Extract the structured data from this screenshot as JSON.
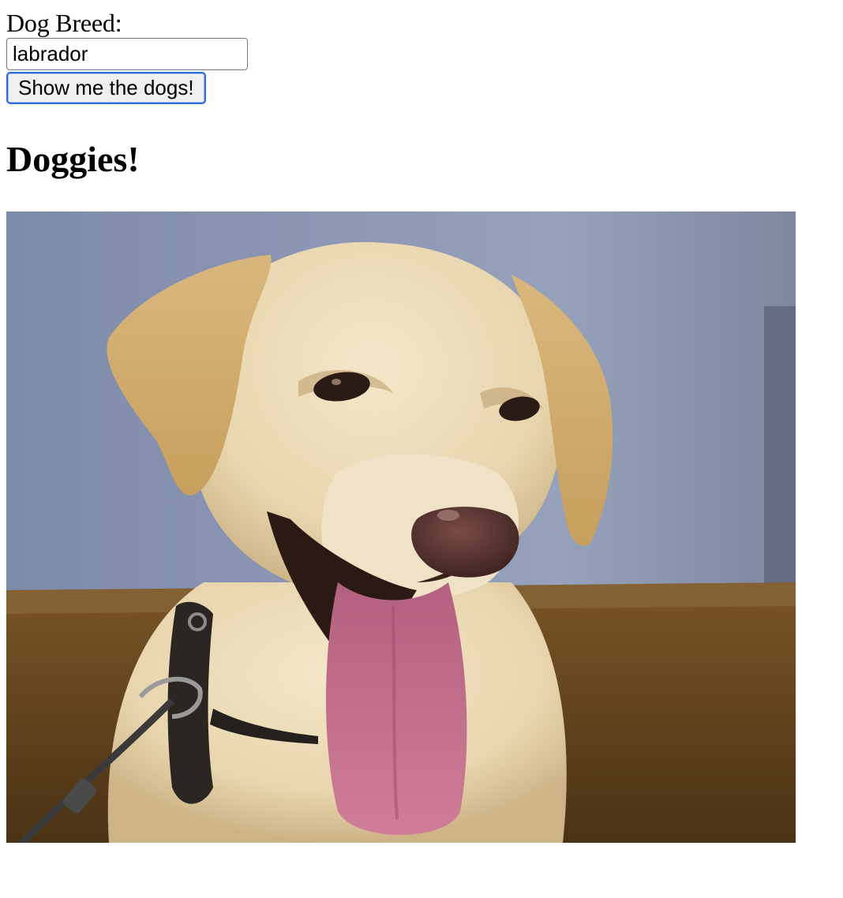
{
  "form": {
    "label": "Dog Breed:",
    "input_value": "labrador",
    "submit_label": "Show me the dogs!"
  },
  "results": {
    "heading": "Doggies!",
    "images": [
      {
        "subject": "yellow labrador retriever with tongue out",
        "icon": "dog-photo"
      }
    ]
  },
  "colors": {
    "button_focus_border": "#2f6ad8",
    "wall": "#7b89a8",
    "floor": "#6b4a1f",
    "fur": "#ecdcb8",
    "tongue": "#c56f8e"
  }
}
